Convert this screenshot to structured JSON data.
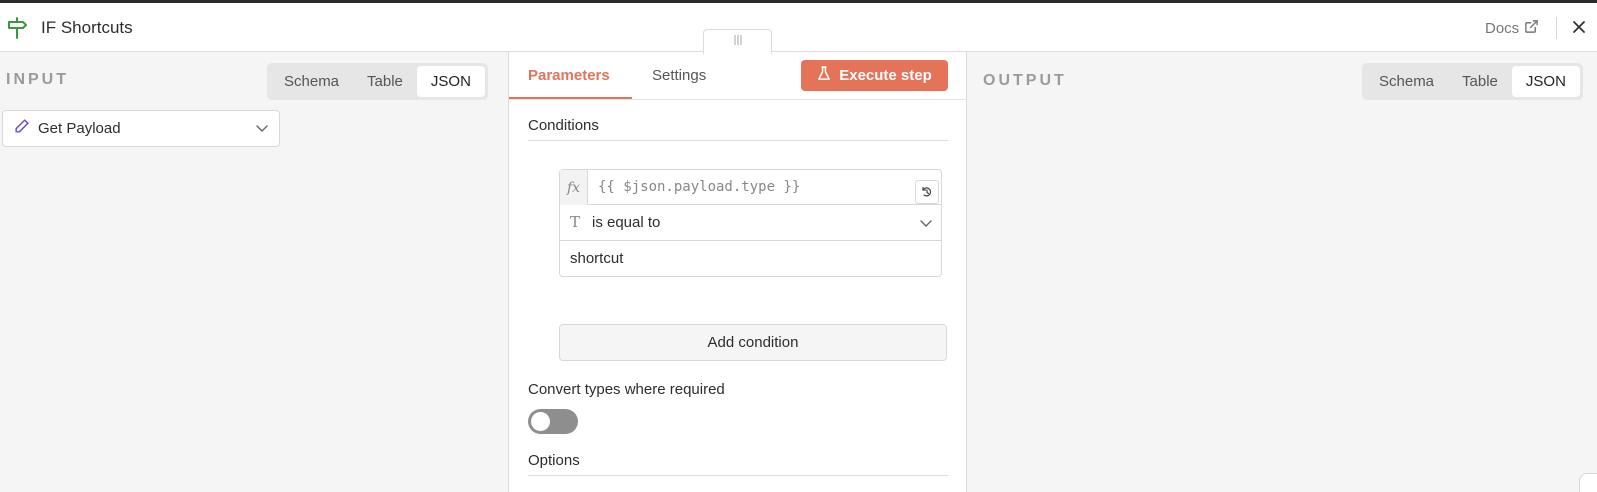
{
  "header": {
    "title": "IF Shortcuts",
    "node_icon": "signpost-icon",
    "docs_label": "Docs",
    "docs_icon": "external-link-icon",
    "close_icon": "close-icon"
  },
  "input_panel": {
    "label": "INPUT",
    "view_tabs": [
      "Schema",
      "Table",
      "JSON"
    ],
    "active_view": "JSON",
    "node_select": {
      "value": "Get Payload",
      "icon": "pencil-icon"
    }
  },
  "parameters_panel": {
    "tabs": [
      "Parameters",
      "Settings"
    ],
    "active_tab": "Parameters",
    "execute_label": "Execute step",
    "execute_icon": "flask-icon",
    "conditions_title": "Conditions",
    "condition": {
      "fx_label": "fx",
      "left_value": "{{ $json.payload.type }}",
      "type_icon": "T",
      "operator": "is equal to",
      "right_value": "shortcut"
    },
    "add_condition_label": "Add condition",
    "convert_types_label": "Convert types where required",
    "convert_types_enabled": false,
    "options_title": "Options"
  },
  "output_panel": {
    "label": "OUTPUT",
    "view_tabs": [
      "Schema",
      "Table",
      "JSON"
    ],
    "active_view": "JSON"
  },
  "colors": {
    "accent": "#e5735a",
    "panel_bg": "#f5f5f5",
    "node_icon": "#3a9a3a",
    "pencil": "#6a4ee0"
  }
}
